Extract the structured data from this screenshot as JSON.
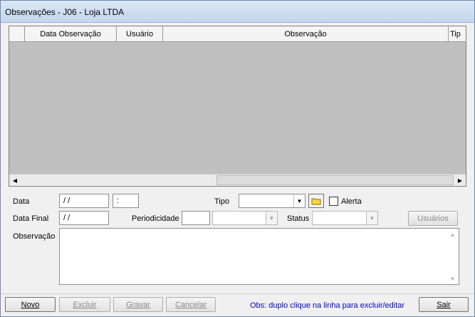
{
  "window": {
    "title": "Observações - J06 - Loja LTDA"
  },
  "grid": {
    "columns": [
      "Data Observação",
      "Usuário",
      "Observação",
      "Tip"
    ],
    "rows": []
  },
  "form": {
    "data_label": "Data",
    "data_value": " / /",
    "hora_value": ":",
    "tipo_label": "Tipo",
    "tipo_value": "",
    "alerta_label": "Alerta",
    "alerta_checked": false,
    "data_final_label": "Data Final",
    "data_final_value": " / /",
    "periodicidade_label": "Periodicidade",
    "periodicidade_value": "",
    "periodicidade_unit": "",
    "status_label": "Status",
    "status_value": "",
    "usuarios_label": "Usuários",
    "observacao_label": "Observação",
    "observacao_value": ""
  },
  "footer": {
    "novo_label": "Novo",
    "excluir_label": "Excluir",
    "gravar_label": "Gravar",
    "cancelar_label": "Cancelar",
    "note": "Obs: duplo clique na linha para excluir/editar",
    "sair_label": "Sair"
  },
  "icons": {
    "folder": "folder-icon",
    "combo_arrow": "chevron-down-icon",
    "scroll_left": "arrow-left-icon",
    "scroll_right": "arrow-right-icon"
  },
  "colors": {
    "grid_body": "#c0c0c0",
    "note_text": "#0000c8",
    "folder_fill": "#f5d742"
  }
}
